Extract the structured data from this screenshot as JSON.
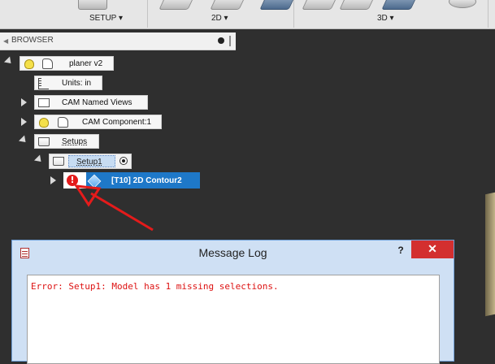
{
  "toolbar": {
    "groups": [
      {
        "label": "SETUP ▾"
      },
      {
        "label": "2D ▾"
      },
      {
        "label": "3D ▾"
      }
    ]
  },
  "browser": {
    "title": "BROWSER",
    "items": [
      {
        "label": "planer v2"
      },
      {
        "label": "Units: in"
      },
      {
        "label": "CAM Named Views"
      },
      {
        "label": "CAM Component:1"
      },
      {
        "label": "Setups"
      },
      {
        "label": "Setup1"
      },
      {
        "label": "[T10] 2D Contour2"
      }
    ],
    "error_symbol": "!"
  },
  "message_log": {
    "title": "Message Log",
    "help": "?",
    "close": "✕",
    "error_text": "Error: Setup1: Model has 1 missing selections."
  },
  "colors": {
    "error_red": "#d11111",
    "selection_blue": "#1e78c8",
    "annotation_arrow": "#e41b1b"
  }
}
